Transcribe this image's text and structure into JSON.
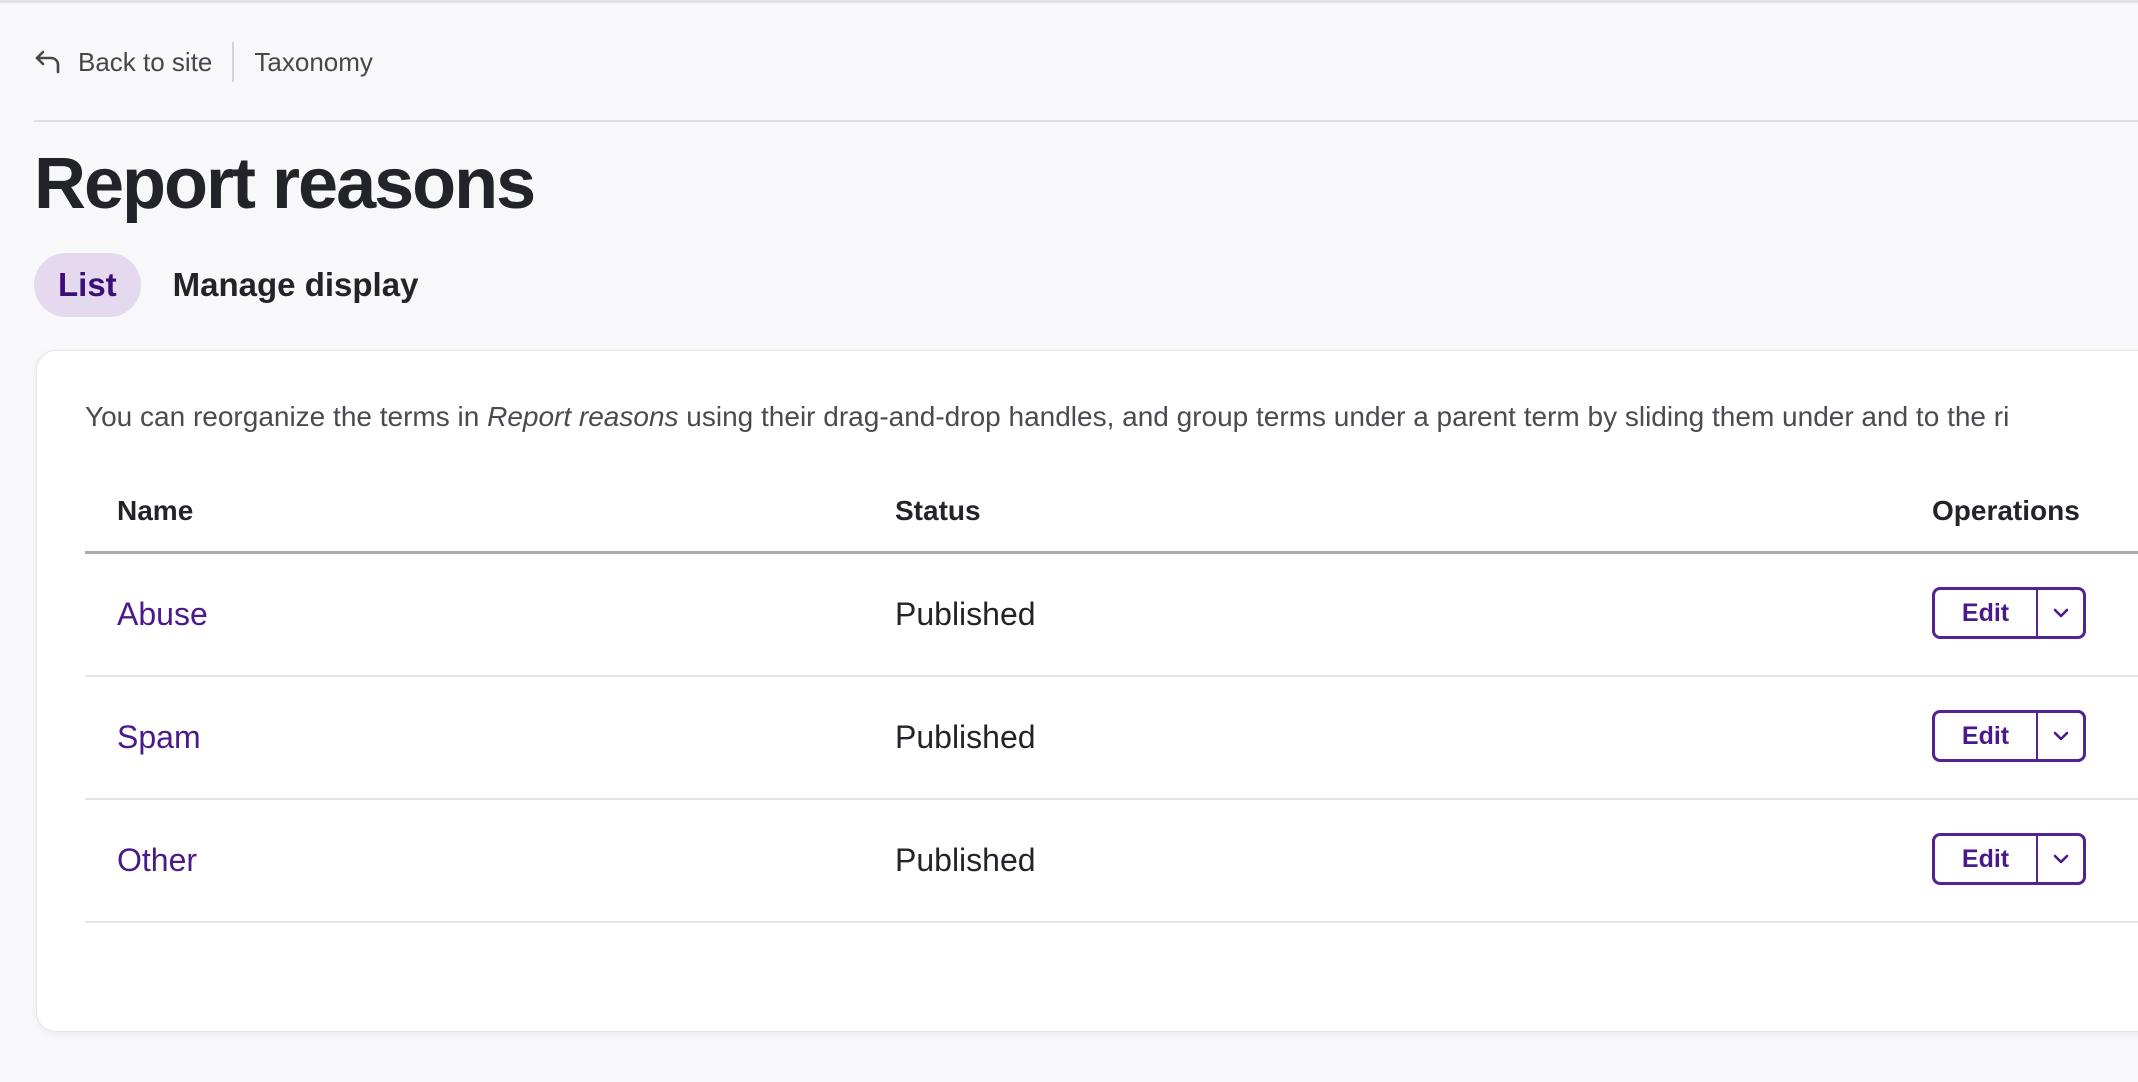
{
  "breadcrumb": {
    "back_label": "Back to site",
    "section": "Taxonomy"
  },
  "page": {
    "title": "Report reasons"
  },
  "tabs": [
    {
      "label": "List",
      "active": true
    },
    {
      "label": "Manage display",
      "active": false
    }
  ],
  "help": {
    "prefix": "You can reorganize the terms in ",
    "vocabulary": "Report reasons",
    "suffix": " using their drag-and-drop handles, and group terms under a parent term by sliding them under and to the ri"
  },
  "table": {
    "headers": {
      "name": "Name",
      "status": "Status",
      "operations": "Operations"
    },
    "rows": [
      {
        "name": "Abuse",
        "status": "Published",
        "edit_label": "Edit"
      },
      {
        "name": "Spam",
        "status": "Published",
        "edit_label": "Edit"
      },
      {
        "name": "Other",
        "status": "Published",
        "edit_label": "Edit"
      }
    ]
  },
  "icons": {
    "back": "arrow-back-icon",
    "dropdown": "chevron-down-icon"
  },
  "colors": {
    "accent": "#55238f",
    "link": "#4a1a8a",
    "active_tab_bg": "#e4d9ef"
  }
}
